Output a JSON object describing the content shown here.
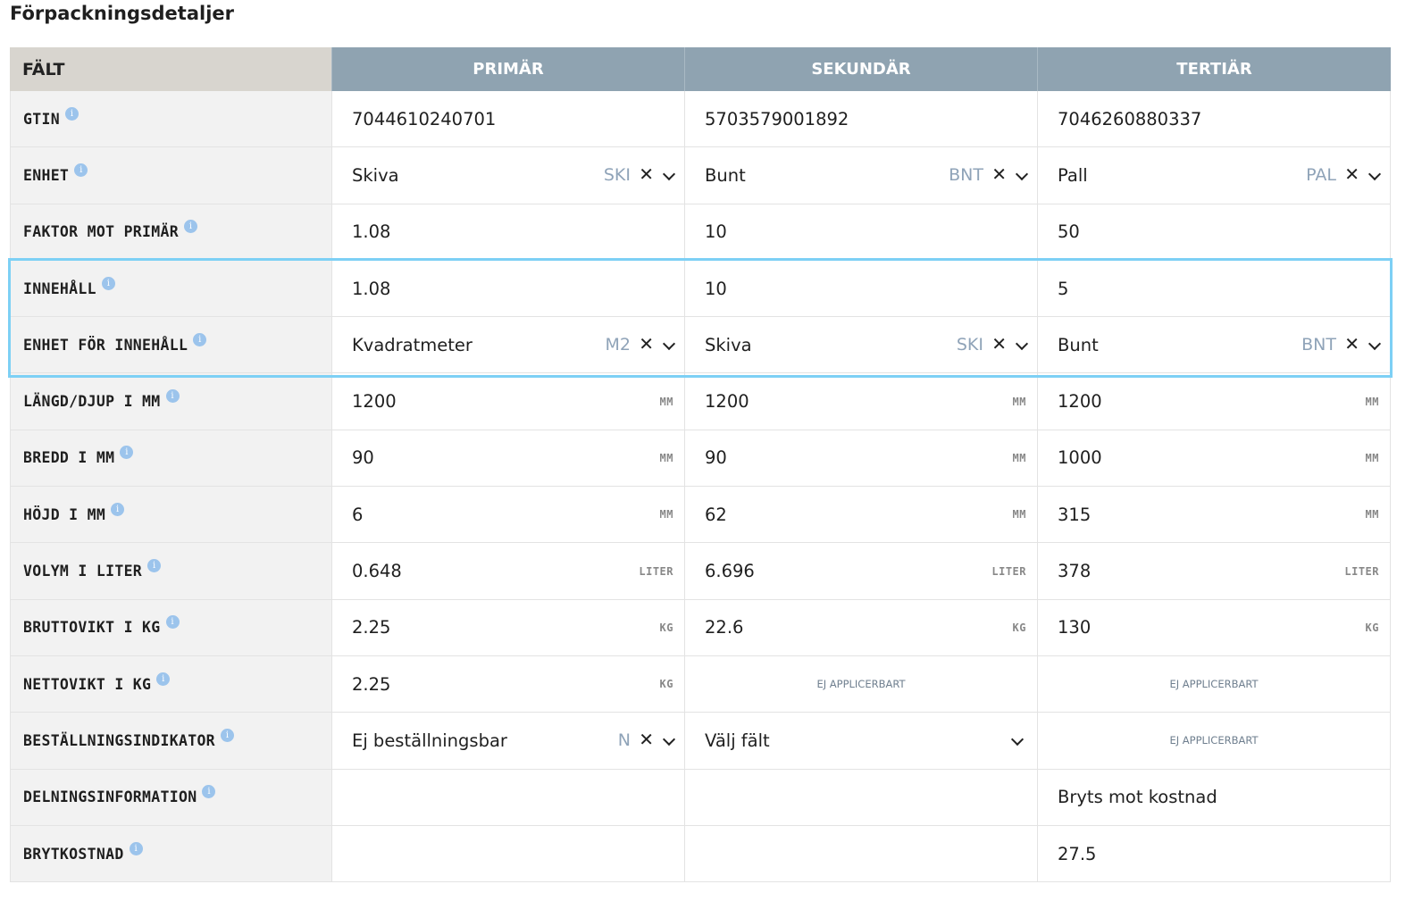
{
  "page_title": "Förpackningsdetaljer",
  "columns": {
    "field": "FÄLT",
    "primary": "PRIMÄR",
    "secondary": "SEKUNDÄR",
    "tertiary": "TERTIÄR"
  },
  "info_glyph": "i",
  "rows": [
    {
      "label": "GTIN",
      "primary": {
        "value": "7044610240701"
      },
      "secondary": {
        "value": "5703579001892"
      },
      "tertiary": {
        "value": "7046260880337"
      }
    },
    {
      "label": "ENHET",
      "primary": {
        "value": "Skiva",
        "code": "SKI"
      },
      "secondary": {
        "value": "Bunt",
        "code": "BNT"
      },
      "tertiary": {
        "value": "Pall",
        "code": "PAL"
      }
    },
    {
      "label": "FAKTOR MOT PRIMÄR",
      "primary": {
        "value": "1.08"
      },
      "secondary": {
        "value": "10"
      },
      "tertiary": {
        "value": "50"
      }
    },
    {
      "label": "INNEHÅLL",
      "primary": {
        "value": "1.08"
      },
      "secondary": {
        "value": "10"
      },
      "tertiary": {
        "value": "5"
      }
    },
    {
      "label": "ENHET FÖR INNEHÅLL",
      "primary": {
        "value": "Kvadratmeter",
        "code": "M2"
      },
      "secondary": {
        "value": "Skiva",
        "code": "SKI"
      },
      "tertiary": {
        "value": "Bunt",
        "code": "BNT"
      }
    },
    {
      "label": "LÄNGD/DJUP I MM",
      "primary": {
        "value": "1200",
        "unit": "MM"
      },
      "secondary": {
        "value": "1200",
        "unit": "MM"
      },
      "tertiary": {
        "value": "1200",
        "unit": "MM"
      }
    },
    {
      "label": "BREDD I MM",
      "primary": {
        "value": "90",
        "unit": "MM"
      },
      "secondary": {
        "value": "90",
        "unit": "MM"
      },
      "tertiary": {
        "value": "1000",
        "unit": "MM"
      }
    },
    {
      "label": "HÖJD I MM",
      "primary": {
        "value": "6",
        "unit": "MM"
      },
      "secondary": {
        "value": "62",
        "unit": "MM"
      },
      "tertiary": {
        "value": "315",
        "unit": "MM"
      }
    },
    {
      "label": "VOLYM I LITER",
      "primary": {
        "value": "0.648",
        "unit": "LITER"
      },
      "secondary": {
        "value": "6.696",
        "unit": "LITER"
      },
      "tertiary": {
        "value": "378",
        "unit": "LITER"
      }
    },
    {
      "label": "BRUTTOVIKT I KG",
      "primary": {
        "value": "2.25",
        "unit": "KG"
      },
      "secondary": {
        "value": "22.6",
        "unit": "KG"
      },
      "tertiary": {
        "value": "130",
        "unit": "KG"
      }
    },
    {
      "label": "NETTOVIKT I KG",
      "primary": {
        "value": "2.25",
        "unit": "KG"
      },
      "secondary": {
        "na": "EJ APPLICERBART"
      },
      "tertiary": {
        "na": "EJ APPLICERBART"
      }
    },
    {
      "label": "BESTÄLLNINGSINDIKATOR",
      "primary": {
        "value": "Ej beställningsbar",
        "code": "N"
      },
      "secondary": {
        "value": "Välj fält"
      },
      "tertiary": {
        "na": "EJ APPLICERBART"
      }
    },
    {
      "label": "DELNINGSINFORMATION",
      "primary": {
        "value": ""
      },
      "secondary": {
        "value": ""
      },
      "tertiary": {
        "value": "Bryts mot kostnad"
      }
    },
    {
      "label": "BRYTKOSTNAD",
      "primary": {
        "value": ""
      },
      "secondary": {
        "value": ""
      },
      "tertiary": {
        "value": "27.5"
      }
    }
  ],
  "highlight_color": "#7dd0f5",
  "header_color": "#8fa3b1"
}
